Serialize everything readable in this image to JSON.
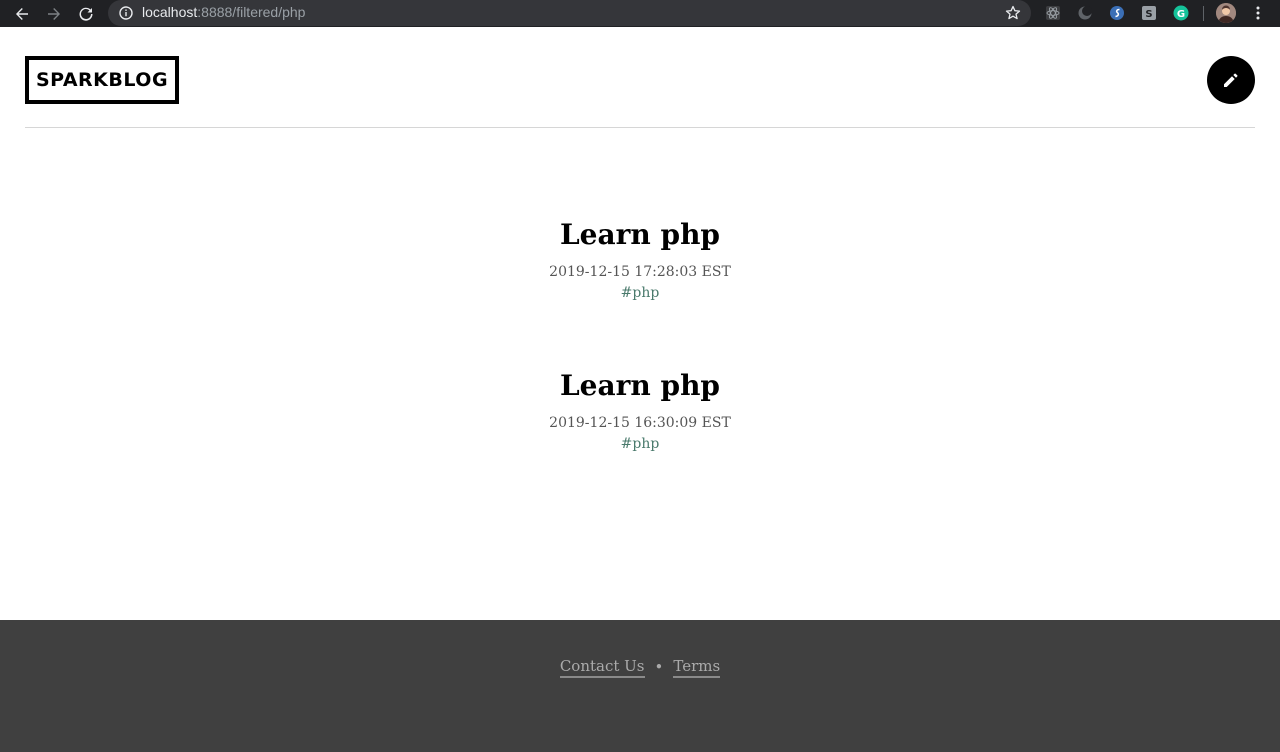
{
  "browser": {
    "url_host": "localhost",
    "url_path": ":8888/filtered/php",
    "icons": [
      "back-icon",
      "forward-icon",
      "reload-icon",
      "info-icon",
      "bookmark-star-icon",
      "extension-react-icon",
      "extension-moon-icon",
      "extension-s-icon",
      "extension-square-icon",
      "grammarly-icon",
      "profile-avatar",
      "menu-icon"
    ]
  },
  "header": {
    "logo": "SPARKBLOG",
    "compose_icon": "pencil-icon"
  },
  "posts": [
    {
      "title": "Learn php",
      "date": "2019-12-15 17:28:03 EST",
      "tag": "#php"
    },
    {
      "title": "Learn php",
      "date": "2019-12-15 16:30:09 EST",
      "tag": "#php"
    }
  ],
  "footer": {
    "contact": "Contact Us",
    "separator": "•",
    "terms": "Terms"
  },
  "colors": {
    "footer_bg": "#404040",
    "tag": "#4a7a6c",
    "chrome_bg": "#202124"
  }
}
